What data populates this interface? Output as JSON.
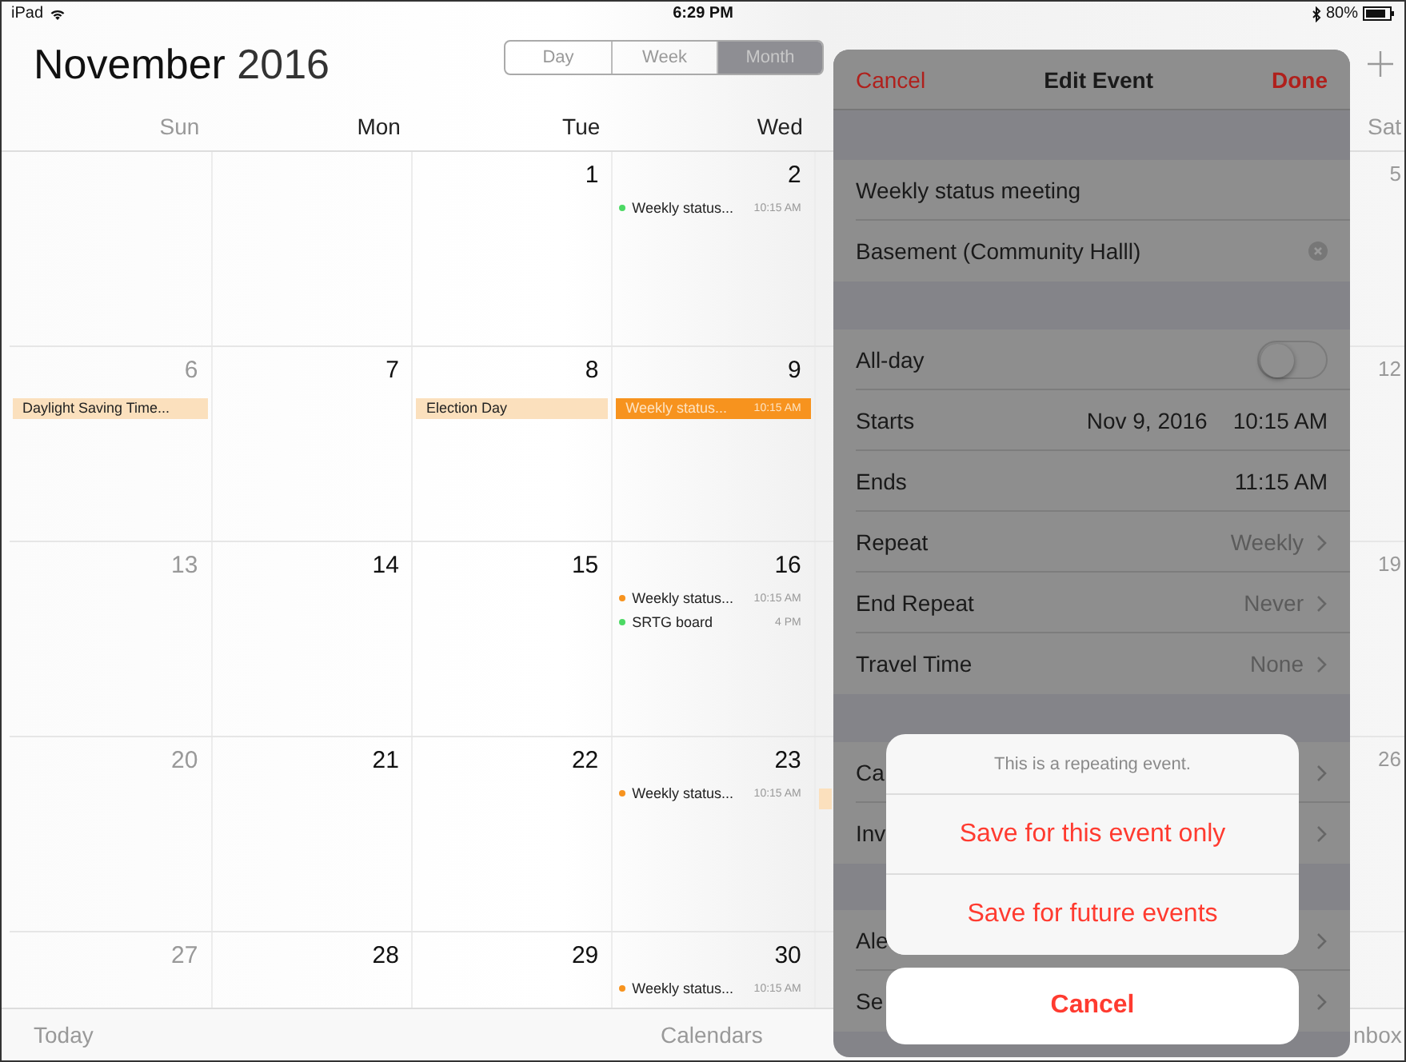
{
  "status_bar": {
    "device": "iPad",
    "time": "6:29 PM",
    "battery": "80%"
  },
  "header": {
    "month": "November",
    "year": "2016"
  },
  "view_switcher": [
    {
      "label": "Day",
      "selected": false
    },
    {
      "label": "Week",
      "selected": false
    },
    {
      "label": "Month",
      "selected": true
    }
  ],
  "calendar": {
    "weekdays": [
      "Sun",
      "Mon",
      "Tue",
      "Wed"
    ],
    "saturday_header": "Sat",
    "weeks": [
      {
        "days": [
          {
            "kind": "blank"
          },
          {
            "kind": "blank"
          },
          {
            "kind": "date",
            "number": "1"
          },
          {
            "kind": "date",
            "number": "2",
            "events": [
              {
                "kind": "timed",
                "title": "Weekly status...",
                "time": "10:15 AM",
                "color": "#4cd964",
                "selected": false
              }
            ]
          }
        ],
        "saturday": "5"
      },
      {
        "days": [
          {
            "kind": "date",
            "number": "6",
            "events": [
              {
                "kind": "allday",
                "title": "Daylight Saving Time...",
                "color": "#fbe0bd",
                "selected": false
              }
            ]
          },
          {
            "kind": "date",
            "number": "7"
          },
          {
            "kind": "date",
            "number": "8",
            "events": [
              {
                "kind": "allday",
                "title": "Election Day",
                "color": "#fbe0bd",
                "selected": false
              }
            ]
          },
          {
            "kind": "date",
            "number": "9",
            "events": [
              {
                "kind": "timed",
                "title": "Weekly status...",
                "time": "10:15 AM",
                "color": "#f7931e",
                "selected": true
              }
            ]
          }
        ],
        "saturday": "12"
      },
      {
        "days": [
          {
            "kind": "date",
            "number": "13"
          },
          {
            "kind": "date",
            "number": "14"
          },
          {
            "kind": "date",
            "number": "15"
          },
          {
            "kind": "date",
            "number": "16",
            "events": [
              {
                "kind": "timed",
                "title": "Weekly status...",
                "time": "10:15 AM",
                "color": "#f7931e",
                "selected": false
              },
              {
                "kind": "timed",
                "title": "SRTG board",
                "time": "4 PM",
                "color": "#4cd964",
                "selected": false
              }
            ]
          }
        ],
        "saturday": "19"
      },
      {
        "days": [
          {
            "kind": "date",
            "number": "20"
          },
          {
            "kind": "date",
            "number": "21"
          },
          {
            "kind": "date",
            "number": "22"
          },
          {
            "kind": "date",
            "number": "23",
            "events": [
              {
                "kind": "timed",
                "title": "Weekly status...",
                "time": "10:15 AM",
                "color": "#f7931e",
                "selected": false
              }
            ]
          }
        ],
        "saturday": "26",
        "hidden_event_edge": true
      },
      {
        "days": [
          {
            "kind": "date",
            "number": "27"
          },
          {
            "kind": "date",
            "number": "28"
          },
          {
            "kind": "date",
            "number": "29"
          },
          {
            "kind": "date",
            "number": "30",
            "events": [
              {
                "kind": "timed",
                "title": "Weekly status...",
                "time": "10:15 AM",
                "color": "#f7931e",
                "selected": false
              }
            ]
          }
        ]
      }
    ]
  },
  "edit_event": {
    "cancel": "Cancel",
    "title": "Edit Event",
    "done": "Done",
    "sections": [
      [
        {
          "kind": "text",
          "label": "Weekly status meeting"
        },
        {
          "kind": "clearable",
          "label": "Basement (Community Halll)"
        }
      ],
      [
        {
          "kind": "toggle",
          "label": "All-day",
          "on": false
        },
        {
          "kind": "value",
          "label": "Starts",
          "values": [
            "Nov 9, 2016",
            "10:15 AM"
          ],
          "chevron": false
        },
        {
          "kind": "value",
          "label": "Ends",
          "values": [
            "11:15 AM"
          ],
          "chevron": false
        },
        {
          "kind": "value",
          "label": "Repeat",
          "values": [
            "Weekly"
          ],
          "chevron": true
        },
        {
          "kind": "value",
          "label": "End Repeat",
          "values": [
            "Never"
          ],
          "chevron": true
        },
        {
          "kind": "value",
          "label": "Travel Time",
          "values": [
            "None"
          ],
          "chevron": true
        }
      ],
      [
        {
          "kind": "value",
          "label": "Ca",
          "chevron": true
        },
        {
          "kind": "value",
          "label": "Inv",
          "chevron": true
        }
      ],
      [
        {
          "kind": "value",
          "label": "Ale",
          "chevron": true
        },
        {
          "kind": "value",
          "label": "Se",
          "chevron": true
        }
      ]
    ]
  },
  "action_sheet": {
    "message": "This is a repeating event.",
    "actions": [
      "Save for this event only",
      "Save for future events"
    ],
    "cancel": "Cancel"
  },
  "toolbar": {
    "today": "Today",
    "calendars": "Calendars",
    "inbox": "nbox"
  }
}
